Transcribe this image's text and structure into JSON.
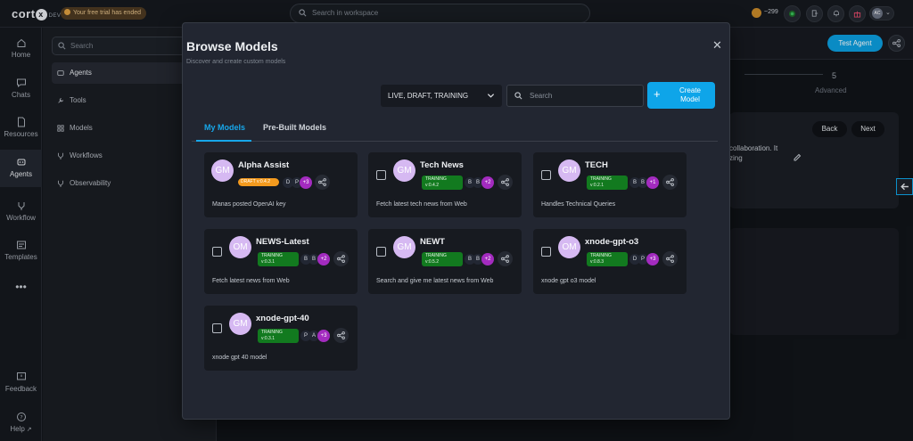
{
  "app": {
    "logo": "cort",
    "logo_mark": "x",
    "env": "DEV",
    "trial_notice": "Your free trial has ended",
    "search_placeholder": "Search in workspace",
    "coins": "~299",
    "user_initials": "AC"
  },
  "rail": [
    {
      "label": "Home",
      "icon": "home-icon"
    },
    {
      "label": "Chats",
      "icon": "chat-icon"
    },
    {
      "label": "Resources",
      "icon": "document-icon"
    },
    {
      "label": "Agents",
      "icon": "agent-icon",
      "active": true
    },
    {
      "label": "Workflow",
      "icon": "workflow-icon"
    },
    {
      "label": "Templates",
      "icon": "template-icon"
    },
    {
      "label": "Feedback",
      "icon": "feedback-icon"
    },
    {
      "label": "Help",
      "icon": "help-icon"
    }
  ],
  "panel": {
    "search_placeholder": "Search",
    "items": [
      {
        "label": "Agents",
        "active": true
      },
      {
        "label": "Tools"
      },
      {
        "label": "Models"
      },
      {
        "label": "Workflows"
      },
      {
        "label": "Observability"
      }
    ]
  },
  "background": {
    "test_agent": "Test Agent",
    "step_number": "5",
    "step_label": "Advanced",
    "back": "Back",
    "next": "Next",
    "text_line1": "collaboration. It",
    "text_line2": "zing"
  },
  "modal": {
    "title": "Browse Models",
    "subtitle": "Discover and create custom models",
    "filter": "LIVE, DRAFT, TRAINING",
    "search_placeholder": "Search",
    "create_label": "Create Model",
    "tabs": [
      "My Models",
      "Pre-Built Models"
    ],
    "cards": [
      {
        "initials": "GM",
        "name": "Alpha Assist",
        "status": "DRAFT",
        "version": "v:0.4.2",
        "users": [
          "D",
          "P"
        ],
        "extra": "+3",
        "desc": "Manas posted OpenAI key",
        "checkbox": false
      },
      {
        "initials": "GM",
        "name": "Tech News",
        "status": "TRAINING",
        "version": "v:0.4.2",
        "users": [
          "B",
          "B"
        ],
        "extra": "+2",
        "desc": "Fetch latest tech news from Web",
        "checkbox": true
      },
      {
        "initials": "GM",
        "name": "TECH",
        "status": "TRAINING",
        "version": "v:0.2.1",
        "users": [
          "B",
          "B"
        ],
        "extra": "+1",
        "desc": "Handles Technical Queries",
        "checkbox": true
      },
      {
        "initials": "OM",
        "name": "NEWS-Latest",
        "status": "TRAINING",
        "version": "v:0.3.1",
        "users": [
          "B",
          "B"
        ],
        "extra": "+2",
        "desc": "Fetch latest news from Web",
        "checkbox": true
      },
      {
        "initials": "GM",
        "name": "NEWT",
        "status": "TRAINING",
        "version": "v:0.5.2",
        "users": [
          "B",
          "B"
        ],
        "extra": "+2",
        "desc": "Search and give me latest news from Web",
        "checkbox": true
      },
      {
        "initials": "OM",
        "name": "xnode-gpt-o3",
        "status": "TRAINING",
        "version": "v:0.8.3",
        "users": [
          "D",
          "P"
        ],
        "extra": "+3",
        "desc": "xnode gpt o3 model",
        "checkbox": true
      },
      {
        "initials": "GM",
        "name": "xnode-gpt-40",
        "status": "TRAINING",
        "version": "v:0.3.1",
        "users": [
          "P",
          "A"
        ],
        "extra": "+3",
        "desc": "xnode gpt 40 model",
        "checkbox": true
      }
    ]
  },
  "colors": {
    "accent": "#0ea5e9",
    "training": "#127a1f",
    "draft": "#f39a1e",
    "extra_badge": "#a32bbf"
  }
}
